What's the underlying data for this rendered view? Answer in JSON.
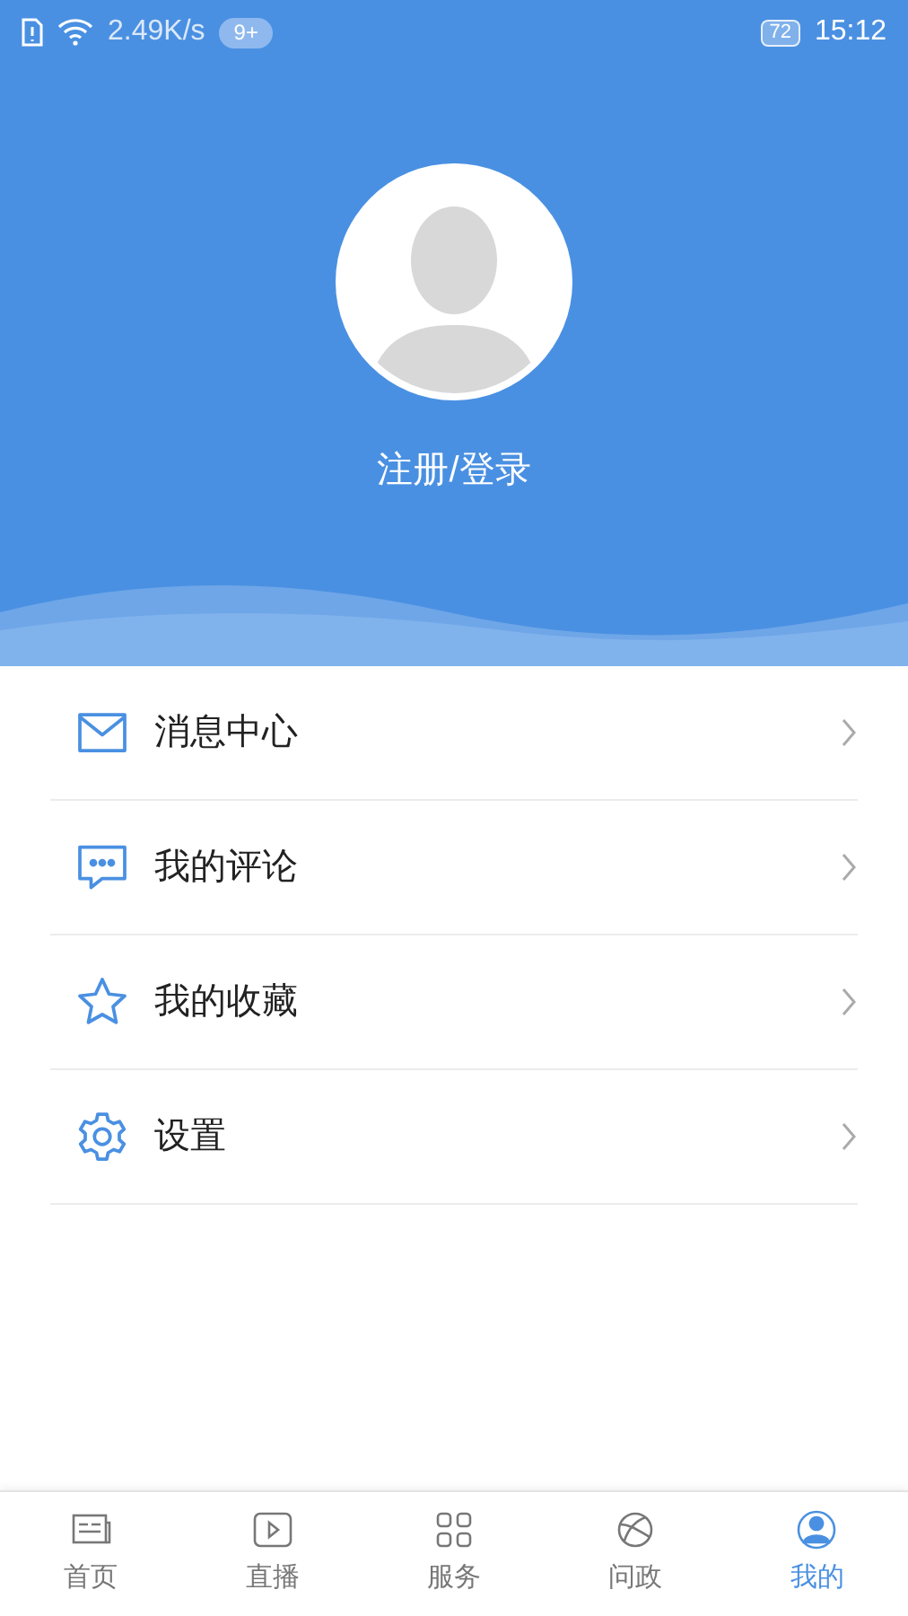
{
  "status_bar": {
    "speed": "2.49K/s",
    "badge": "9+",
    "battery": "72",
    "time": "15:12"
  },
  "profile": {
    "login": "注册/登录"
  },
  "menu": [
    {
      "kind": "mail",
      "label": "消息中心"
    },
    {
      "kind": "comment",
      "label": "我的评论"
    },
    {
      "kind": "star",
      "label": "我的收藏"
    },
    {
      "kind": "gear",
      "label": "设置"
    }
  ],
  "tabs": [
    {
      "kind": "news",
      "label": "首页",
      "selected": false
    },
    {
      "kind": "play",
      "label": "直播",
      "selected": false
    },
    {
      "kind": "grid",
      "label": "服务",
      "selected": false
    },
    {
      "kind": "globe",
      "label": "问政",
      "selected": false
    },
    {
      "kind": "user",
      "label": "我的",
      "selected": true
    }
  ]
}
